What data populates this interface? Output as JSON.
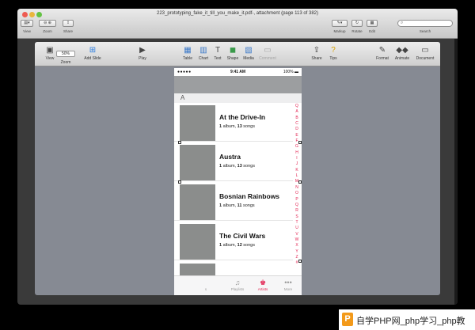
{
  "preview": {
    "title": "223_prototyping_fake_it_till_you_make_it.pdf-, attachment (page 113 of 382)",
    "toolbar_labels": {
      "view": "View",
      "zoom": "Zoom",
      "share": "Share",
      "markup": "Markup",
      "rotate": "Rotate",
      "edit": "Edit",
      "search": "Search"
    }
  },
  "keynote": {
    "toolbar": {
      "view": "View",
      "zoom_value": "50%",
      "zoom": "Zoom",
      "add_slide": "Add Slide",
      "play": "Play",
      "table": "Table",
      "chart": "Chart",
      "text": "Text",
      "shape": "Shape",
      "media": "Media",
      "comment": "Comment",
      "share": "Share",
      "tips": "Tips",
      "format": "Format",
      "animate": "Animate",
      "document": "Document"
    }
  },
  "phone": {
    "status": {
      "carrier": "●●●●● ",
      "time": "9:41 AM",
      "battery": "100%"
    },
    "section_header": "A",
    "artists": [
      {
        "name": "At the Drive-In",
        "albums": "1",
        "albums_word": " album, ",
        "songs": "13",
        "songs_word": " songs"
      },
      {
        "name": "Austra",
        "albums": "1",
        "albums_word": " album, ",
        "songs": "13",
        "songs_word": " songs"
      },
      {
        "name": "Bosnian Rainbows",
        "albums": "1",
        "albums_word": " album, ",
        "songs": "11",
        "songs_word": " songs"
      },
      {
        "name": "The Civil Wars",
        "albums": "1",
        "albums_word": " album, ",
        "songs": "12",
        "songs_word": " songs"
      }
    ],
    "index": [
      "Q",
      "A",
      "B",
      "C",
      "D",
      "E",
      "F",
      "G",
      "H",
      "I",
      "J",
      "K",
      "L",
      "M",
      "N",
      "O",
      "P",
      "Q",
      "R",
      "S",
      "T",
      "U",
      "V",
      "W",
      "X",
      "Y",
      "Z",
      "#"
    ],
    "tabs": [
      {
        "label": "Playlists"
      },
      {
        "label": "Artists"
      },
      {
        "label": "More"
      }
    ],
    "tab_partial": "s",
    "accent_color": "#e2204f"
  },
  "watermark": {
    "logo": "P",
    "text": "自学PHP网_php学习_php教"
  }
}
